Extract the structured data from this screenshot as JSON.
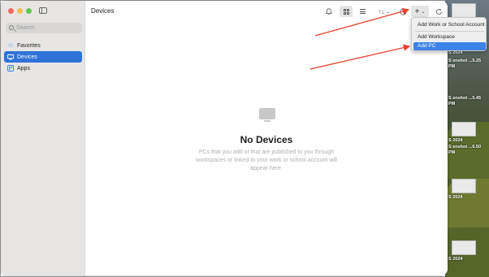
{
  "window": {
    "title": "Devices"
  },
  "sidebar": {
    "search_placeholder": "Search",
    "items": [
      {
        "label": "Favorites",
        "icon": "star-icon",
        "active": false
      },
      {
        "label": "Devices",
        "icon": "monitor-icon",
        "active": true
      },
      {
        "label": "Apps",
        "icon": "apps-icon",
        "active": false
      }
    ]
  },
  "toolbar": {
    "add_label": "+",
    "sort_label": "↑↓"
  },
  "empty_state": {
    "title": "No Devices",
    "description": "PCs that you add or that are published to you through workspaces or linked to your work or school account will appear here."
  },
  "add_menu": {
    "items": [
      {
        "label": "Add Work or School Account"
      },
      {
        "label": "Add Workspace"
      },
      {
        "label": "Add PC",
        "highlighted": true
      }
    ]
  },
  "desktop_files": [
    {
      "label": "S 2024"
    },
    {
      "label": "S enshot ...5.25 PM"
    },
    {
      "label": "S enshot ...5.45 PM"
    },
    {
      "label": "S 2024"
    },
    {
      "label": "S enshot ...6.50 PM"
    },
    {
      "label": "S 2024"
    },
    {
      "label": "S 2024"
    }
  ],
  "colors": {
    "accent": "#2f73d9",
    "annotation_arrow": "#e8402a"
  }
}
